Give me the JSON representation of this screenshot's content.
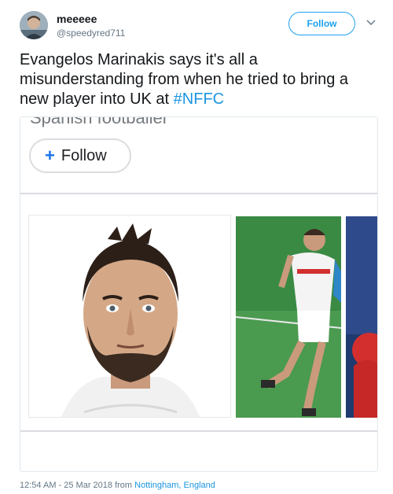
{
  "tweet": {
    "display_name": "meeeee",
    "handle": "@speedyred711",
    "follow_label": "Follow",
    "text_main": "Evangelos Marinakis says it's all a misunderstanding from when he tried to bring a new player into UK at ",
    "hashtag": "#NFFC",
    "timestamp_prefix": "12:54 AM - 25 Mar 2018 from ",
    "location": "Nottingham, England"
  },
  "card": {
    "cut_off_text": "Spanish footballer",
    "follow_label": "Follow",
    "follow_plus": "+"
  },
  "icons": {
    "chevron": "chevron-down-icon",
    "plus": "plus-icon"
  },
  "colors": {
    "accent": "#1da1f2",
    "link": "#1b95e0",
    "google_blue": "#1a73e8"
  }
}
